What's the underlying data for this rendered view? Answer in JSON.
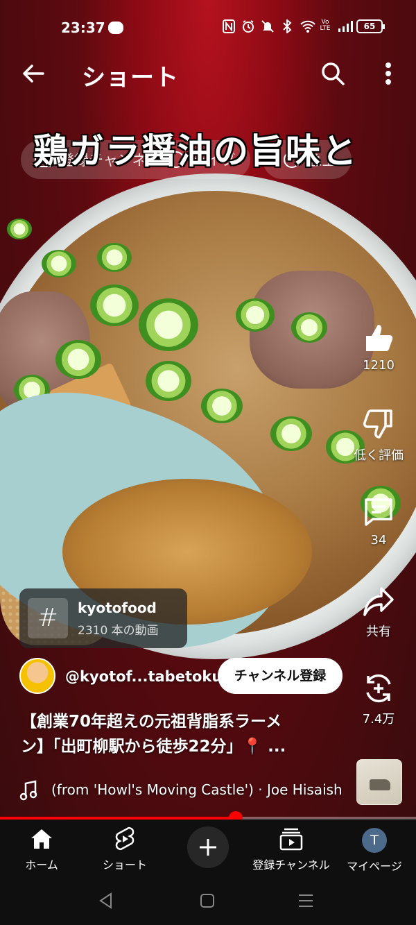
{
  "status_bar": {
    "time": "23:37",
    "battery": "65",
    "icons": [
      "line-icon",
      "nfc-icon",
      "alarm-icon",
      "mute-icon",
      "bluetooth-icon",
      "wifi-icon",
      "volte-icon",
      "signal-icon",
      "battery-icon"
    ],
    "volte_label": "Vo LTE"
  },
  "app_bar": {
    "title": "ショート"
  },
  "chips": [
    {
      "label": "登録チャンネル"
    },
    {
      "label": "ライブ"
    },
    {
      "label": "急上"
    }
  ],
  "video": {
    "caption": "鶏ガラ醤油の旨味と",
    "title": "【創業70年超えの元祖背脂系ラーメン】「出町柳駅から徒歩22分」📍...",
    "title_line1": "【創業70年超えの元祖背脂系ラーメ",
    "title_line2": "ン】「出町柳駅から徒歩22分」📍 ...",
    "progress_fraction": 0.567
  },
  "actions": {
    "like_count": "1210",
    "dislike_label": "低く評価",
    "comment_count": "34",
    "share_label": "共有",
    "remix_count": "7.4万"
  },
  "hashtag": {
    "symbol": "#",
    "name": "kyotofood",
    "count": "2310 本の動画"
  },
  "channel": {
    "handle": "@kyotof...tabetoku",
    "subscribe_label": "チャンネル登録"
  },
  "music": {
    "text": "(from 'Howl's Moving Castle') · Joe Hisaishi"
  },
  "bottom_nav": {
    "home": "ホーム",
    "shorts": "ショート",
    "subscriptions": "登録チャンネル",
    "profile": "マイページ",
    "profile_initial": "T"
  },
  "colors": {
    "accent_red": "#ff0000",
    "nav_bg": "#0f0f0f"
  }
}
